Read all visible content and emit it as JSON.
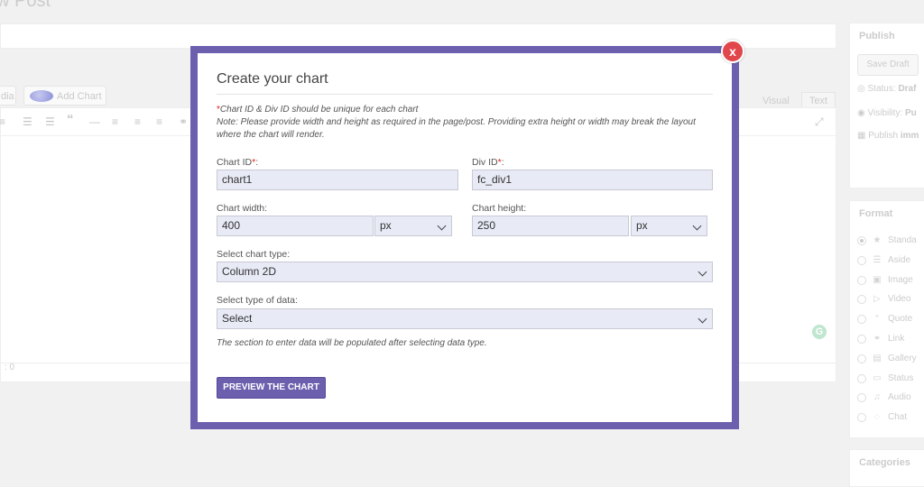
{
  "background": {
    "page_title": "w Post",
    "media_button": "dia",
    "add_chart_button": "Add Chart",
    "editor_tabs": [
      "Visual",
      "Text"
    ],
    "word_count": ": 0",
    "publish": {
      "title": "Publish",
      "save_draft": "Save Draft",
      "status_label": "Status:",
      "status_value": "Draf",
      "visibility_label": "Visibility:",
      "visibility_value": "Pu",
      "schedule_label": "Publish",
      "schedule_value": "imm"
    },
    "format": {
      "title": "Format",
      "options": [
        "Standa",
        "Aside",
        "Image",
        "Video",
        "Quote",
        "Link",
        "Gallery",
        "Status",
        "Audio",
        "Chat"
      ]
    },
    "categories_title": "Categories"
  },
  "modal": {
    "title": "Create your chart",
    "required_mark": "*",
    "note_required": "Chart ID & Div ID should be unique for each chart",
    "note_size_line1": "Note: Please provide width and height as required in the page/post. Providing extra height or width may break the layout",
    "note_size_line2": "where the chart will render.",
    "chart_id_label": "Chart ID",
    "chart_id_value": "chart1",
    "div_id_label": "Div ID",
    "div_id_value": "fc_div1",
    "width_label": "Chart width:",
    "width_value": "400",
    "width_unit": "px",
    "height_label": "Chart height:",
    "height_value": "250",
    "height_unit": "px",
    "chart_type_label": "Select chart type:",
    "chart_type_value": "Column 2D",
    "data_type_label": "Select type of data:",
    "data_type_value": "Select",
    "help_text": "The section to enter data will be populated after selecting data type.",
    "preview_button": "PREVIEW THE CHART",
    "close_symbol": "x"
  },
  "colors": {
    "modal_frame": "#6c5fae",
    "close_button": "#e0464b",
    "input_background": "#e8eaf6",
    "required": "#e0201c"
  }
}
